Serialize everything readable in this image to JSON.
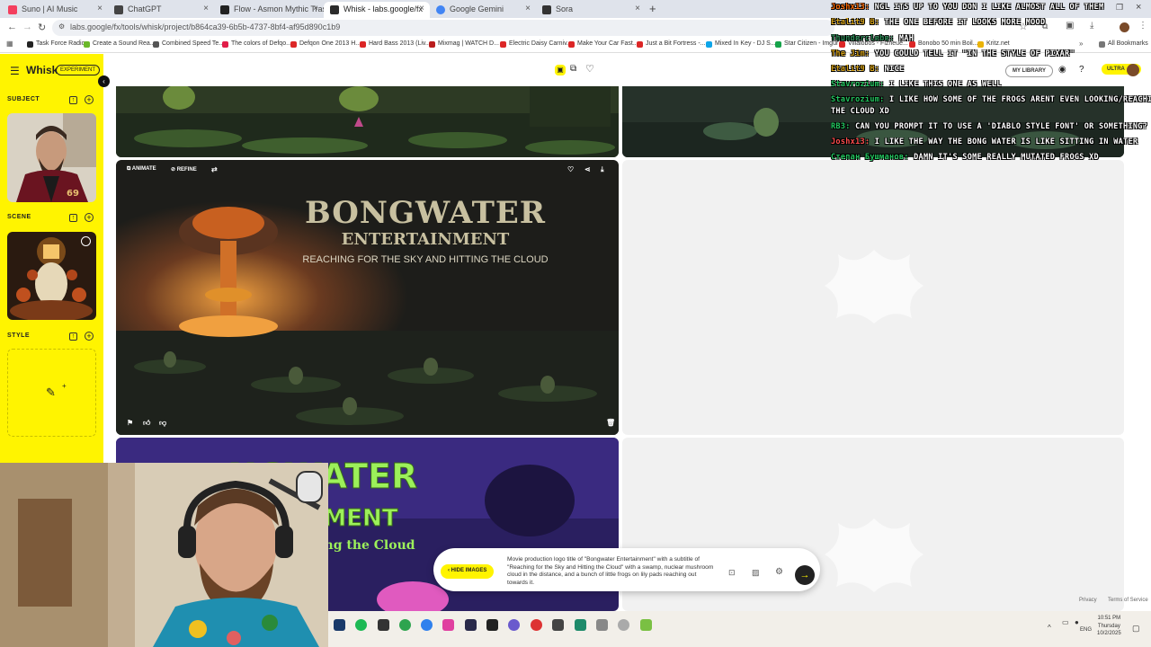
{
  "browser": {
    "tabs": [
      {
        "label": "Suno | AI Music",
        "color": "#f43f5e"
      },
      {
        "label": "ChatGPT",
        "color": "#444444"
      },
      {
        "label": "Flow - Asmon Mythic Trash",
        "color": "#222222"
      },
      {
        "label": "Whisk - labs.google/fx",
        "color": "#2b2b2b",
        "active": true
      },
      {
        "label": "Google Gemini",
        "color": "#4285f4"
      },
      {
        "label": "Sora",
        "color": "#333333"
      }
    ],
    "url": "labs.google/fx/tools/whisk/project/b864ca39-6b5b-4737-8bf4-af95d890c1b9",
    "bookmarks": [
      {
        "label": "Task Force Radio",
        "color": "#222222"
      },
      {
        "label": "Create a Sound Rea...",
        "color": "#6bb82a"
      },
      {
        "label": "Combined Speed Te...",
        "color": "#555555"
      },
      {
        "label": "The colors of Defqo...",
        "color": "#e11d48"
      },
      {
        "label": "Defqon One 2013 H...",
        "color": "#dc2626"
      },
      {
        "label": "Hard Bass 2013 (Liv...",
        "color": "#dc2626"
      },
      {
        "label": "Mixmag | WATCH D...",
        "color": "#b91c1c"
      },
      {
        "label": "Electric Daisy Carniv...",
        "color": "#dc2626"
      },
      {
        "label": "Make Your Car Fast...",
        "color": "#dc2626"
      },
      {
        "label": "Just a Bit Fortress -...",
        "color": "#dc2626"
      },
      {
        "label": "Mixed In Key - DJ S...",
        "color": "#0ea5e9"
      },
      {
        "label": "Star Citizen - Imgur",
        "color": "#16a34a"
      },
      {
        "label": "Villalobos - Fizheue...",
        "color": "#dc2626"
      },
      {
        "label": "Bonobo 50 min Boil...",
        "color": "#dc2626"
      },
      {
        "label": "Kritz.net",
        "color": "#eab308"
      }
    ],
    "all_bookmarks": "All Bookmarks"
  },
  "whisk": {
    "brand": "Whisk",
    "badge": "EXPERIMENT",
    "sections": {
      "subject": "SUBJECT",
      "scene": "SCENE",
      "style": "STYLE"
    },
    "my_library": "MY LIBRARY",
    "ultra": "ULTRA",
    "card_tools": {
      "animate": "ANIMATE",
      "refine": "REFINE"
    },
    "poster": {
      "title": "BONGWATER",
      "subtitle": "ENTERTAINMENT",
      "tagline": "REACHING FOR THE SKY AND HITTING THE CLOUD"
    },
    "poster2": {
      "title": "NGWATER",
      "subtitle": "ERTAINMENT",
      "tagline": "e Sky AND Hitting the Cloud"
    },
    "prompt": {
      "hide_label": "HIDE IMAGES",
      "text": "Movie production logo title of \"Bongwater Entertainment\" with a subtitle of \"Reaching for the Sky and Hitting the Cloud\" with a swamp, nuclear mushroom cloud in the distance, and a bunch of little frogs on lily pads reaching out towards it."
    },
    "footer": {
      "privacy": "Privacy",
      "terms": "Terms of Service"
    }
  },
  "chat": [
    {
      "user": "Joshx13:",
      "msg": "NGL ITS UP TO YOU DON I LIKE ALMOST ALL OF THEM",
      "color": "#ff6a00"
    },
    {
      "user": "Etalit9 B:",
      "msg": "THE ONE BEFORE IT LOOKS MORE MOOD",
      "color": "#d4a017"
    },
    {
      "user": "Thunderclebe:",
      "msg": "MAH",
      "color": "#2e8b57"
    },
    {
      "user": "The Jim:",
      "msg": "YOU COULD TELL IT \"IN THE STYLE OF PIXAR\"",
      "color": "#d4a017"
    },
    {
      "user": "Etalit9 B:",
      "msg": "NICE",
      "color": "#d4a017"
    },
    {
      "user": "Stavrozium:",
      "msg": "I LIKE THIS ONE AS WELL",
      "color": "#22c55e"
    },
    {
      "user": "Stavrozium:",
      "msg": "I LIKE HOW SOME OF THE FROGS ARENT EVEN LOOKING/REACHING AT",
      "color": "#22c55e"
    },
    {
      "user": "",
      "msg": "THE CLOUD XD",
      "color": "#22c55e"
    },
    {
      "user": "RB3:",
      "msg": "CAN YOU PROMPT IT TO USE A 'DIABLO STYLE FONT' OR SOMETHING?",
      "color": "#22c55e"
    },
    {
      "user": "Joshx13:",
      "msg": "I LIKE THE WAY THE BONG WATER IS LIKE SITTING IN WATER",
      "color": "#ff4d4d"
    },
    {
      "user": "Степан Бушманов:",
      "msg": "DAMN IT'S SOME REALLY MUTATED FROGS XD",
      "color": "#22c55e"
    }
  ],
  "taskbar": {
    "lang": "ENG",
    "time": "10:51 PM",
    "day": "Thursday",
    "date": "10/2/2025"
  }
}
